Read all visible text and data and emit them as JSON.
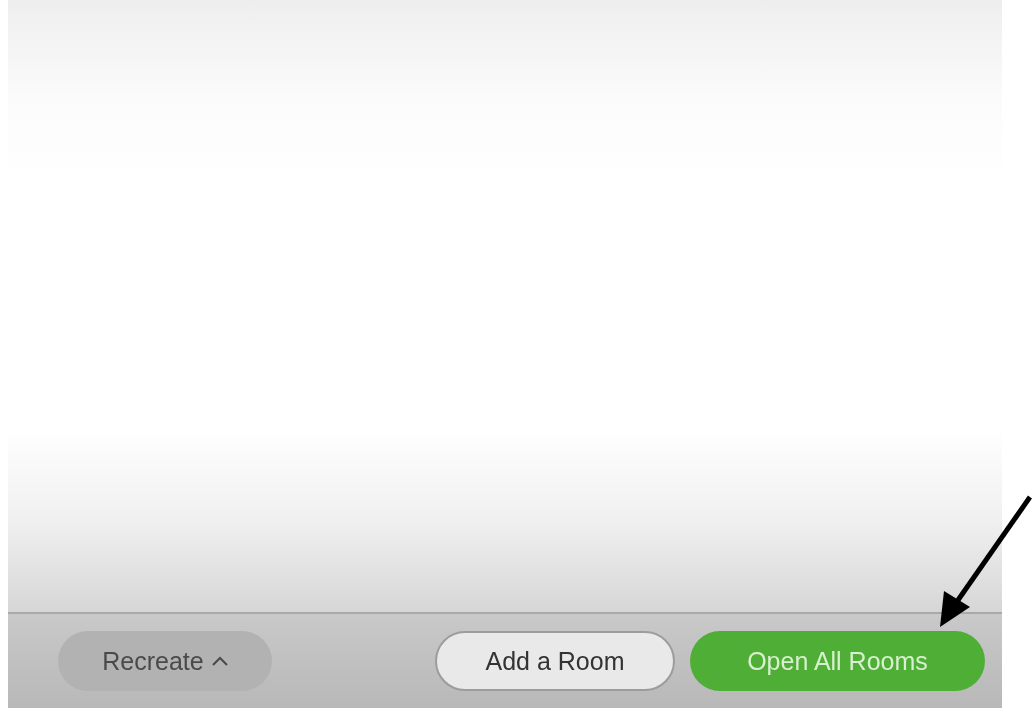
{
  "footer": {
    "buttons": [
      {
        "label": "Recreate",
        "kind": "menu"
      },
      {
        "label": "Add a Room",
        "kind": "secondary"
      },
      {
        "label": "Open All Rooms",
        "kind": "primary"
      }
    ]
  }
}
